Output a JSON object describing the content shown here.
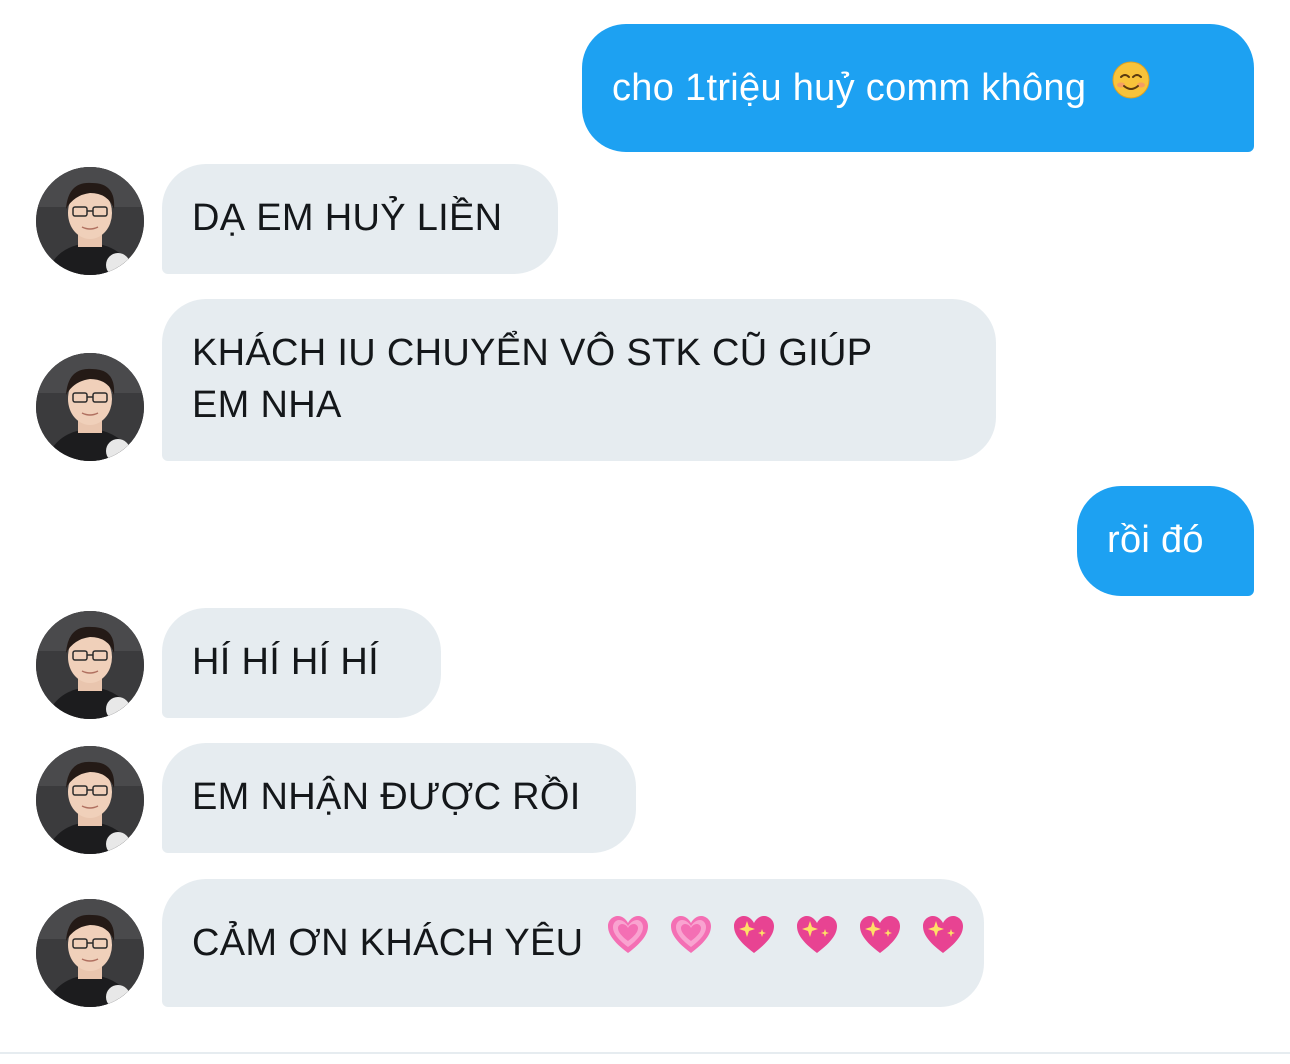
{
  "messages": [
    {
      "side": "sent",
      "text": "cho 1triệu huỷ comm không",
      "emoji": "smiling-face-emoji"
    },
    {
      "side": "received",
      "text": "DẠ EM HUỶ LIỀN"
    },
    {
      "side": "received",
      "line1": "KHÁCH IU CHUYỂN VÔ STK CŨ GIÚP",
      "line2": "EM NHA"
    },
    {
      "side": "sent",
      "text": "rồi đó"
    },
    {
      "side": "received",
      "text": "HÍ HÍ HÍ HÍ"
    },
    {
      "side": "received",
      "text": "EM NHẬN ĐƯỢC RỒI"
    },
    {
      "side": "received",
      "text": "CẢM ƠN KHÁCH YÊU",
      "emojis": [
        "growing-heart-emoji",
        "growing-heart-emoji",
        "sparkling-heart-emoji",
        "sparkling-heart-emoji",
        "sparkling-heart-emoji",
        "sparkling-heart-emoji"
      ]
    }
  ],
  "colors": {
    "sent_bubble": "#1da1f2",
    "received_bubble": "#e6ecf0",
    "received_text": "#14171a",
    "sent_text": "#ffffff"
  }
}
